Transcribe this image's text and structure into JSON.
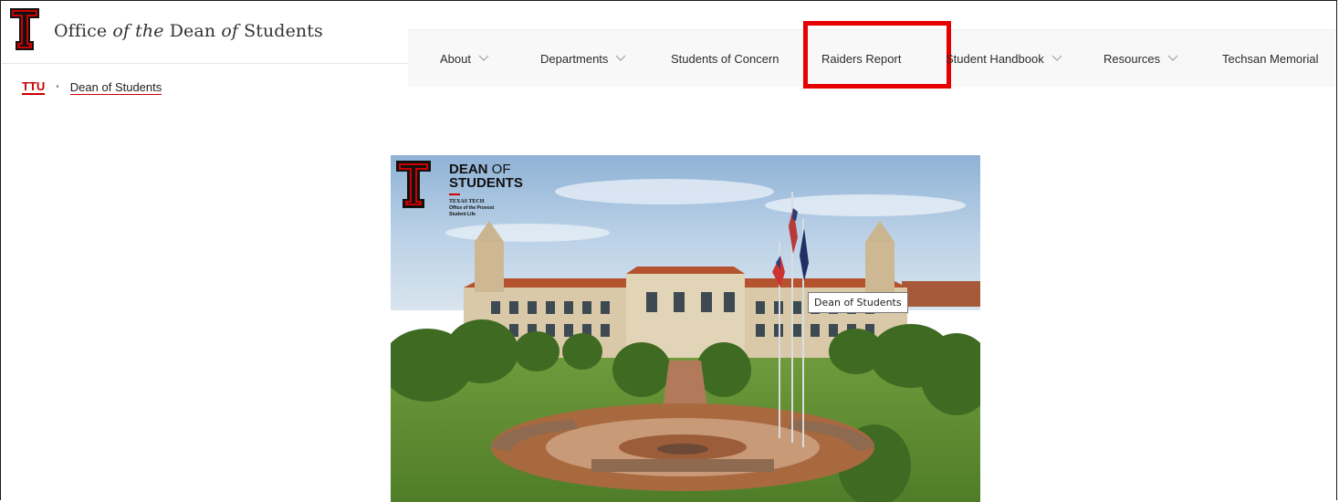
{
  "header": {
    "title_parts": {
      "a": "Office ",
      "b": "of the",
      "c": " Dean ",
      "d": "of",
      "e": " Students"
    }
  },
  "nav": {
    "items": [
      {
        "label": "About",
        "has_dropdown": true
      },
      {
        "label": "Departments",
        "has_dropdown": true
      },
      {
        "label": "Students of Concern",
        "has_dropdown": false
      },
      {
        "label": "Raiders Report",
        "has_dropdown": false
      },
      {
        "label": "Student Handbook",
        "has_dropdown": true
      },
      {
        "label": "Resources",
        "has_dropdown": true
      },
      {
        "label": "Techsan Memorial",
        "has_dropdown": false
      }
    ]
  },
  "breadcrumb": {
    "root": "TTU",
    "separator": "•",
    "current": "Dean of Students"
  },
  "hero": {
    "logo_line1_bold": "DEAN",
    "logo_line1_thin": " OF",
    "logo_line2": "STUDENTS",
    "logo_sub1": "TEXAS TECH",
    "logo_sub2": "Office of the Provost",
    "logo_sub3": "Student Life",
    "tooltip": "Dean of Students"
  },
  "colors": {
    "brand_red": "#cc0000",
    "highlight_red": "#e60000",
    "nav_bg": "#f8f8f8"
  }
}
